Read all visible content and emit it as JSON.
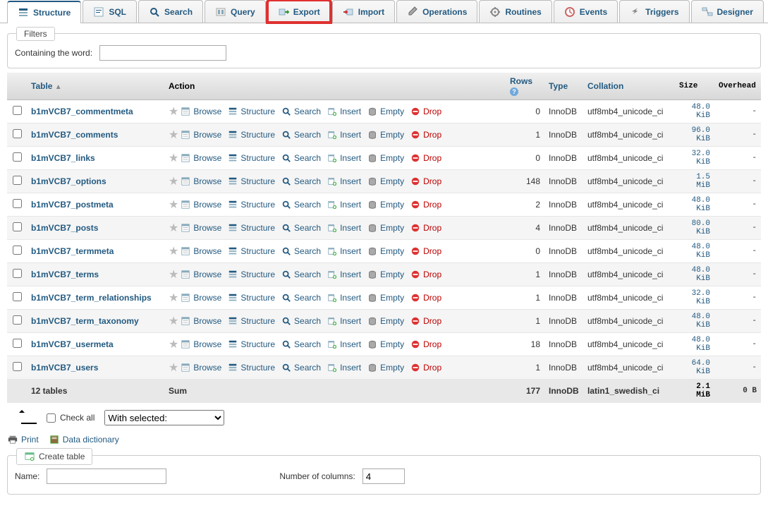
{
  "tabs": [
    {
      "label": "Structure",
      "name": "structure",
      "active": true
    },
    {
      "label": "SQL",
      "name": "sql"
    },
    {
      "label": "Search",
      "name": "search"
    },
    {
      "label": "Query",
      "name": "query"
    },
    {
      "label": "Export",
      "name": "export",
      "highlight": true
    },
    {
      "label": "Import",
      "name": "import"
    },
    {
      "label": "Operations",
      "name": "operations"
    },
    {
      "label": "Routines",
      "name": "routines"
    },
    {
      "label": "Events",
      "name": "events"
    },
    {
      "label": "Triggers",
      "name": "triggers"
    },
    {
      "label": "Designer",
      "name": "designer"
    }
  ],
  "filters": {
    "legend": "Filters",
    "label": "Containing the word:",
    "value": ""
  },
  "headers": {
    "table": "Table",
    "action": "Action",
    "rows": "Rows",
    "type": "Type",
    "collation": "Collation",
    "size": "Size",
    "overhead": "Overhead"
  },
  "actions": {
    "browse": "Browse",
    "structure": "Structure",
    "search": "Search",
    "insert": "Insert",
    "empty": "Empty",
    "drop": "Drop"
  },
  "rows": [
    {
      "name": "b1mVCB7_commentmeta",
      "rows": 0,
      "type": "InnoDB",
      "collation": "utf8mb4_unicode_ci",
      "size": "48.0 KiB",
      "overhead": "-"
    },
    {
      "name": "b1mVCB7_comments",
      "rows": 1,
      "type": "InnoDB",
      "collation": "utf8mb4_unicode_ci",
      "size": "96.0 KiB",
      "overhead": "-"
    },
    {
      "name": "b1mVCB7_links",
      "rows": 0,
      "type": "InnoDB",
      "collation": "utf8mb4_unicode_ci",
      "size": "32.0 KiB",
      "overhead": "-"
    },
    {
      "name": "b1mVCB7_options",
      "rows": 148,
      "type": "InnoDB",
      "collation": "utf8mb4_unicode_ci",
      "size": "1.5 MiB",
      "overhead": "-"
    },
    {
      "name": "b1mVCB7_postmeta",
      "rows": 2,
      "type": "InnoDB",
      "collation": "utf8mb4_unicode_ci",
      "size": "48.0 KiB",
      "overhead": "-"
    },
    {
      "name": "b1mVCB7_posts",
      "rows": 4,
      "type": "InnoDB",
      "collation": "utf8mb4_unicode_ci",
      "size": "80.0 KiB",
      "overhead": "-"
    },
    {
      "name": "b1mVCB7_termmeta",
      "rows": 0,
      "type": "InnoDB",
      "collation": "utf8mb4_unicode_ci",
      "size": "48.0 KiB",
      "overhead": "-"
    },
    {
      "name": "b1mVCB7_terms",
      "rows": 1,
      "type": "InnoDB",
      "collation": "utf8mb4_unicode_ci",
      "size": "48.0 KiB",
      "overhead": "-"
    },
    {
      "name": "b1mVCB7_term_relationships",
      "rows": 1,
      "type": "InnoDB",
      "collation": "utf8mb4_unicode_ci",
      "size": "32.0 KiB",
      "overhead": "-"
    },
    {
      "name": "b1mVCB7_term_taxonomy",
      "rows": 1,
      "type": "InnoDB",
      "collation": "utf8mb4_unicode_ci",
      "size": "48.0 KiB",
      "overhead": "-"
    },
    {
      "name": "b1mVCB7_usermeta",
      "rows": 18,
      "type": "InnoDB",
      "collation": "utf8mb4_unicode_ci",
      "size": "48.0 KiB",
      "overhead": "-"
    },
    {
      "name": "b1mVCB7_users",
      "rows": 1,
      "type": "InnoDB",
      "collation": "utf8mb4_unicode_ci",
      "size": "64.0 KiB",
      "overhead": "-"
    }
  ],
  "sum": {
    "label": "12 tables",
    "action": "Sum",
    "rows": 177,
    "type": "InnoDB",
    "collation": "latin1_swedish_ci",
    "size": "2.1 MiB",
    "overhead": "0 B"
  },
  "footer": {
    "checkall": "Check all",
    "withsel_placeholder": "With selected:",
    "print": "Print",
    "datadict": "Data dictionary"
  },
  "create": {
    "legend": "Create table",
    "name_label": "Name:",
    "name_value": "",
    "cols_label": "Number of columns:",
    "cols_value": "4"
  }
}
